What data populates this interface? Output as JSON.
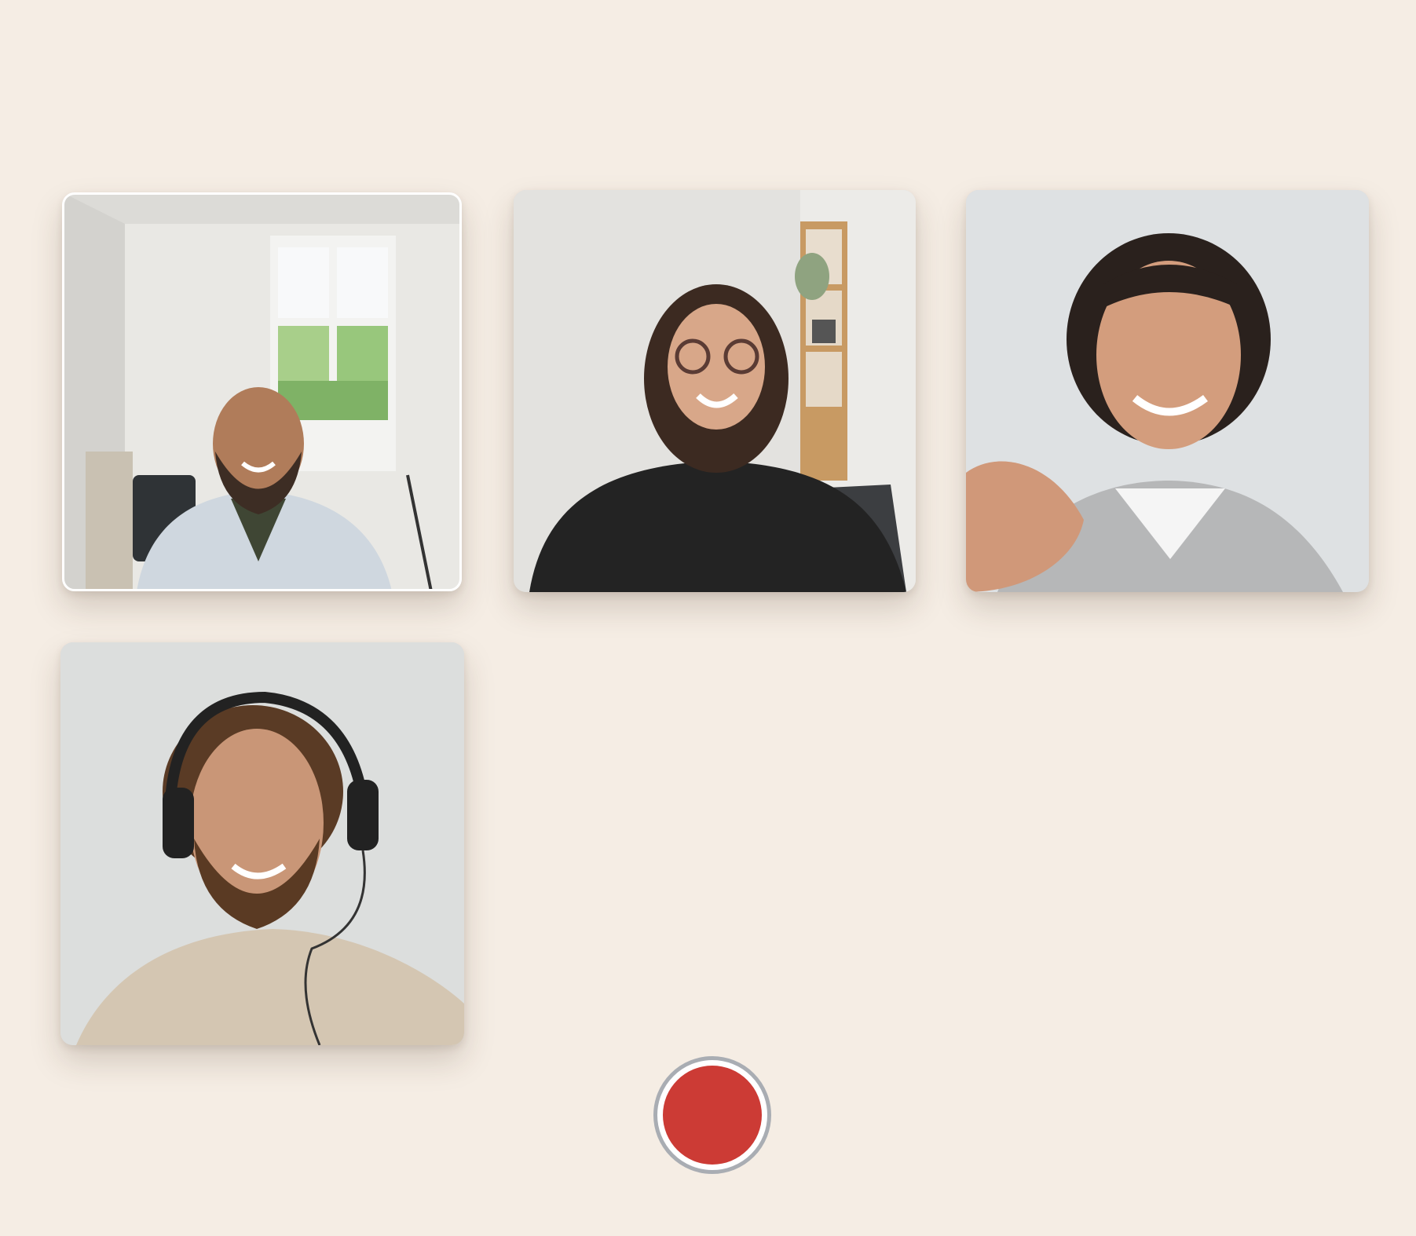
{
  "colors": {
    "background": "#f5ede4",
    "record_red": "#cc3b35",
    "record_ring": "#a9adb3"
  },
  "participants": [
    {
      "icon": "video-feed-man-bald-beard",
      "active_speaker": true
    },
    {
      "icon": "video-feed-woman-curly-glasses",
      "active_speaker": false
    },
    {
      "icon": "video-feed-woman-waving",
      "active_speaker": false
    },
    {
      "icon": "video-feed-man-headphones",
      "active_speaker": false
    }
  ],
  "controls": {
    "record_icon": "record-icon"
  }
}
